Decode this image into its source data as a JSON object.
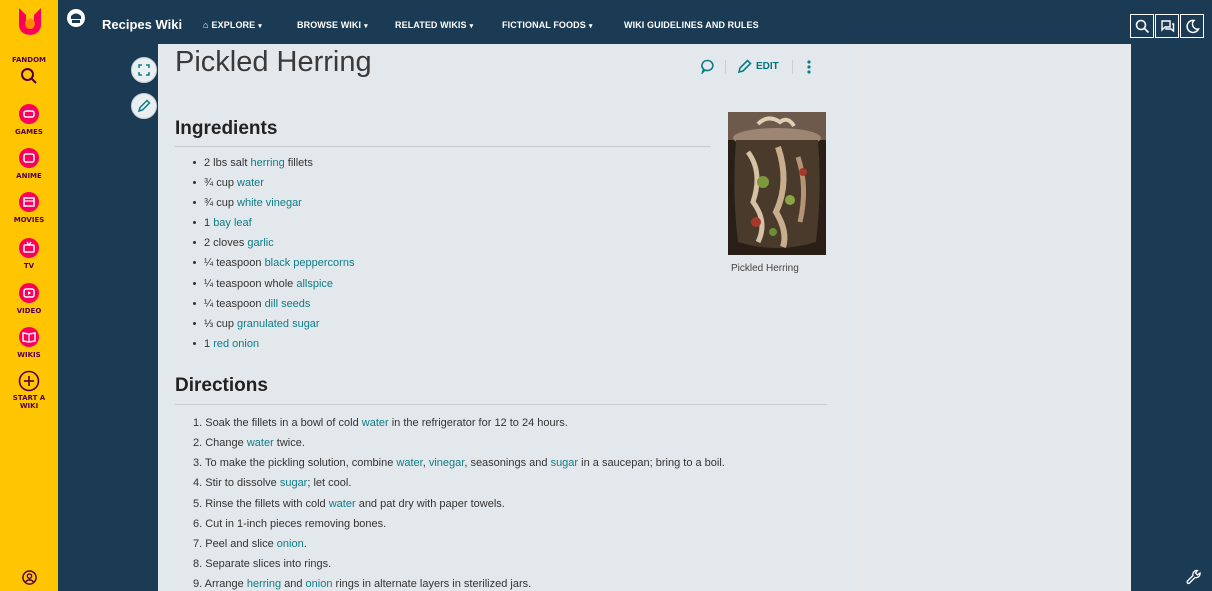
{
  "rail": {
    "items": [
      {
        "label": "FANDOM",
        "icon": "search-icon"
      },
      {
        "label": "GAMES",
        "icon": "games-icon"
      },
      {
        "label": "ANIME",
        "icon": "anime-icon"
      },
      {
        "label": "MOVIES",
        "icon": "movies-icon"
      },
      {
        "label": "TV",
        "icon": "tv-icon"
      },
      {
        "label": "VIDEO",
        "icon": "video-icon"
      },
      {
        "label": "WIKIS",
        "icon": "wikis-icon"
      },
      {
        "label": "START A",
        "label2": "WIKI",
        "icon": "plus-icon"
      }
    ]
  },
  "header": {
    "wiki_name": "Recipes Wiki",
    "nav": [
      {
        "label": "EXPLORE",
        "caret": "▾"
      },
      {
        "label": "BROWSE WIKI",
        "caret": "▾"
      },
      {
        "label": "RELATED WIKIS",
        "caret": "▾"
      },
      {
        "label": "FICTIONAL FOODS",
        "caret": "▾"
      },
      {
        "label": "WIKI GUIDELINES AND RULES",
        "caret": ""
      }
    ]
  },
  "page": {
    "title": "Pickled Herring",
    "edit_label": "EDIT",
    "ingredients_heading": "Ingredients",
    "directions_heading": "Directions",
    "image_caption": "Pickled Herring",
    "ingredients": [
      {
        "pre": "2 lbs salt ",
        "link": "herring",
        "post": " fillets"
      },
      {
        "pre": "¾ cup ",
        "link": "water",
        "post": ""
      },
      {
        "pre": "¾ cup ",
        "link": "white vinegar",
        "post": ""
      },
      {
        "pre": "1 ",
        "link": "bay leaf",
        "post": ""
      },
      {
        "pre": "2 cloves ",
        "link": "garlic",
        "post": ""
      },
      {
        "pre": "¼ teaspoon ",
        "link": "black peppercorns",
        "post": ""
      },
      {
        "pre": "¼ teaspoon whole ",
        "link": "allspice",
        "post": ""
      },
      {
        "pre": "¼ teaspoon ",
        "link": "dill seeds",
        "post": ""
      },
      {
        "pre": "⅓ cup ",
        "link": "granulated sugar",
        "post": ""
      },
      {
        "pre": "1 ",
        "link": "red onion",
        "post": ""
      }
    ],
    "directions": [
      [
        {
          "t": "1. Soak the fillets in a bowl of cold "
        },
        {
          "t": "water",
          "link": true
        },
        {
          "t": " in the refrigerator for 12 to 24 hours."
        }
      ],
      [
        {
          "t": "2. Change "
        },
        {
          "t": "water",
          "link": true
        },
        {
          "t": " twice."
        }
      ],
      [
        {
          "t": "3. To make the pickling solution, combine "
        },
        {
          "t": "water",
          "link": true
        },
        {
          "t": ", "
        },
        {
          "t": "vinegar",
          "link": true
        },
        {
          "t": ", seasonings and "
        },
        {
          "t": "sugar",
          "link": true
        },
        {
          "t": " in a saucepan; bring to a boil."
        }
      ],
      [
        {
          "t": "4. Stir to dissolve "
        },
        {
          "t": "sugar",
          "link": true
        },
        {
          "t": "; let cool."
        }
      ],
      [
        {
          "t": "5. Rinse the fillets with cold "
        },
        {
          "t": "water",
          "link": true
        },
        {
          "t": " and pat dry with paper towels."
        }
      ],
      [
        {
          "t": "6. Cut in 1-inch pieces removing bones."
        }
      ],
      [
        {
          "t": "7. Peel and slice "
        },
        {
          "t": "onion",
          "link": true
        },
        {
          "t": "."
        }
      ],
      [
        {
          "t": "8. Separate slices into rings."
        }
      ],
      [
        {
          "t": "9. Arrange "
        },
        {
          "t": "herring",
          "link": true
        },
        {
          "t": " and "
        },
        {
          "t": "onion",
          "link": true
        },
        {
          "t": " rings in alternate layers in sterilized jars."
        }
      ]
    ]
  },
  "colors": {
    "rail": "#ffc500",
    "navy": "#1b3a53",
    "link": "#0e7c86",
    "brand": "#520044"
  }
}
